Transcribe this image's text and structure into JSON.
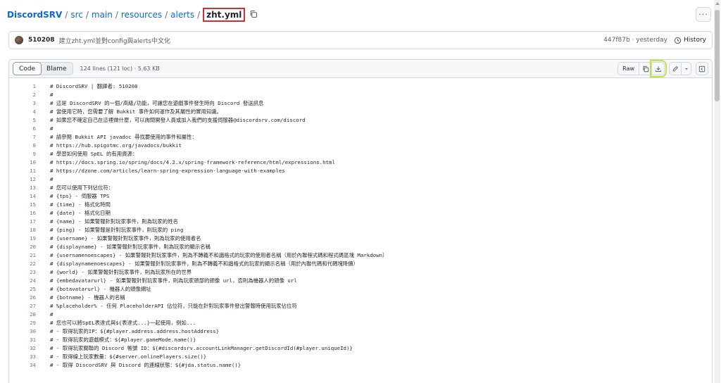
{
  "breadcrumb": {
    "repo": "DiscordSRV",
    "path": [
      "src",
      "main",
      "resources",
      "alerts"
    ],
    "separator": "/",
    "file": "zht.yml"
  },
  "more_button": "···",
  "commit": {
    "author": "510208",
    "message": "建立zht.yml並對config與alerts中文化",
    "sha_time": "447f87b · yesterday",
    "history_label": "History"
  },
  "file_header": {
    "tab_code": "Code",
    "tab_blame": "Blame",
    "stats": "124 lines (121 loc) · 5.63 KB",
    "raw_label": "Raw"
  },
  "code_lines": [
    {
      "n": "1",
      "t": "# DiscordSRV | 翻譯者: 510208"
    },
    {
      "n": "2",
      "t": "#"
    },
    {
      "n": "3",
      "t": "# 這是 DiscordSRV 的一個/高級/功能，可讓您在遊戲事件發生時向 Discord 發送訊息"
    },
    {
      "n": "4",
      "t": "# 當使用它時，您需要了解 Bukkit 事件如何運作及其屬性的實用知識。"
    },
    {
      "n": "5",
      "t": "# 如果您不確定自己在這裡做什麼，可以詢問開發人員或加入我們的支援伺服器@discordsrv.com/discord"
    },
    {
      "n": "6",
      "t": "#"
    },
    {
      "n": "7",
      "t": "# 請參閱 Bukkit API javadoc 尋找要使用的事件和屬性："
    },
    {
      "n": "8",
      "t": "# https://hub.spigotmc.org/javadocs/bukkit"
    },
    {
      "n": "9",
      "t": "# 學習如何使用 SpEL 的有用資源："
    },
    {
      "n": "10",
      "t": "# https://docs.spring.io/spring/docs/4.2.x/spring-framework-reference/html/expressions.html"
    },
    {
      "n": "11",
      "t": "# https://dzone.com/articles/learn-spring-expression-language-with-examples"
    },
    {
      "n": "12",
      "t": "#"
    },
    {
      "n": "13",
      "t": "# 您可以使用下列佔位符："
    },
    {
      "n": "14",
      "t": "# {tps} - 伺服器 TPS"
    },
    {
      "n": "15",
      "t": "# {time} - 格式化時間"
    },
    {
      "n": "16",
      "t": "# {date} - 格式化日期"
    },
    {
      "n": "17",
      "t": "# {name} - 如果警報針對玩家事件，則為玩家的姓名"
    },
    {
      "n": "18",
      "t": "# {ping} - 如果警報是針對玩家事件，則玩家的 ping"
    },
    {
      "n": "19",
      "t": "# {username} - 如果警報針對玩家事件，則為玩家的使用者名"
    },
    {
      "n": "20",
      "t": "# {displayname} - 如果警報針對玩家事件，則為玩家的顯示名稱"
    },
    {
      "n": "21",
      "t": "# {usernamenoescapes} - 如果警報針對玩家事件，則為不轉義不和諧格式的玩家的使用者名稱（用於內聯程式碼和程式碼區塊 Markdown）"
    },
    {
      "n": "22",
      "t": "# {displaynamenoescapes} - 如果警報針對玩家事件，則為不轉義不和諧格式的玩家的顯示名稱（用於內聯代碼和代碼塊降價）"
    },
    {
      "n": "23",
      "t": "# {world} - 如果警報針對玩家事件，則為玩家所在的世界"
    },
    {
      "n": "24",
      "t": "# {embedavatarurl} - 如果警報針對玩家事件，則為玩家頭部的頭像 url，否則為機器人的頭像 url"
    },
    {
      "n": "25",
      "t": "# {botavatarurl} - 機器人的頭像網址"
    },
    {
      "n": "26",
      "t": "# {botname} - 機器人的名稱"
    },
    {
      "n": "27",
      "t": "# %placeholder% - 任何 PlaceholderAPI 佔位符，只能在針對玩家事件發出警報時使用玩家佔位符"
    },
    {
      "n": "28",
      "t": "#"
    },
    {
      "n": "29",
      "t": "# 您也可以將SpEL表達式與${表達式...}一起使用，例如..."
    },
    {
      "n": "30",
      "t": "# - 取得玩家的IP：${#player.address.address.hostAddress}"
    },
    {
      "n": "31",
      "t": "# - 取得玩家的遊戲模式：${#player.gameMode.name()}"
    },
    {
      "n": "32",
      "t": "# - 取得玩家關聯的 Discord 帳號 ID：${#discordsrv.accountLinkManager.getDiscordId(#player.uniqueId)}"
    },
    {
      "n": "33",
      "t": "# - 取得線上玩家數量：${#server.onlinePlayers.size()}"
    },
    {
      "n": "34",
      "t": "# - 取得 DiscordSRV 與 Discord 的連線狀態：${#jda.status.name()}"
    }
  ]
}
